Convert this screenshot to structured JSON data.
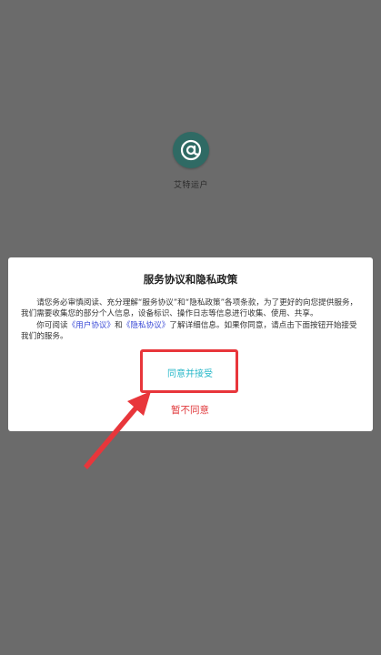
{
  "app": {
    "name": "艾特运户",
    "icon": "at-sign-icon"
  },
  "dialog": {
    "title": "服务协议和隐私政策",
    "paragraph1": "请您务必审慎阅读、充分理解“服务协议”和“隐私政策”各项条款，为了更好的向您提供服务，我们需要收集您的部分个人信息，设备标识、操作日志等信息进行收集、使用、共享。",
    "paragraph2_prefix": "你可阅读",
    "user_agreement_link": "《用户协议》",
    "paragraph2_and": "和",
    "privacy_policy_link": "《隐私协议》",
    "paragraph2_suffix": "了解详细信息。如果你同意，请点击下面按钮开始接受我们的服务。",
    "agree_label": "同意并接受",
    "decline_label": "暂不同意"
  },
  "colors": {
    "overlay": "#6b6b6b",
    "app_icon": "#2f6a64",
    "link": "#3a4ad6",
    "agree": "#29b8c9",
    "decline": "#e0383b",
    "highlight": "#e8363b"
  }
}
